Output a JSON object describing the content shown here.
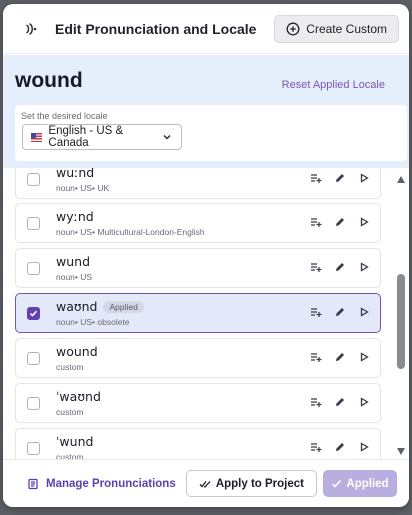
{
  "dialog": {
    "title": "Edit Pronunciation and Locale",
    "create_label": "Create Custom",
    "header_icon": "pronunciation-sound-icon",
    "create_icon": "plus-circle-icon"
  },
  "word_panel": {
    "word": "wound",
    "reset_label": "Reset Applied Locale"
  },
  "locale": {
    "label": "Set the desired locale",
    "selected": "English - US & Canada",
    "flag_icon": "us-flag-icon"
  },
  "rows": [
    {
      "ipa": "wuːnd",
      "meta": "noun• US• UK",
      "checked": false,
      "applied": false
    },
    {
      "ipa": "wyːnd",
      "meta": "noun• US• Multicultural-London-English",
      "checked": false,
      "applied": false
    },
    {
      "ipa": "wund",
      "meta": "noun• US",
      "checked": false,
      "applied": false
    },
    {
      "ipa": "waʊnd",
      "meta": "noun• US• obsolete",
      "checked": true,
      "applied": true,
      "badge": "Applied"
    },
    {
      "ipa": "wound",
      "meta": "custom",
      "checked": false,
      "applied": false
    },
    {
      "ipa": "ˈwaʊnd",
      "meta": "custom",
      "checked": false,
      "applied": false
    },
    {
      "ipa": "ˈwund",
      "meta": "custom",
      "checked": false,
      "applied": false
    }
  ],
  "row_actions": [
    "playlist-add-icon",
    "pencil-icon",
    "play-icon"
  ],
  "footer": {
    "manage_label": "Manage Pronunciations",
    "apply_project_label": "Apply to Project",
    "applied_label": "Applied"
  },
  "colors": {
    "accent": "#6140b0",
    "panel_bg": "#e5eefb",
    "selected_row_bg": "#e3e9f9",
    "applied_button_bg": "#b9aee0"
  }
}
